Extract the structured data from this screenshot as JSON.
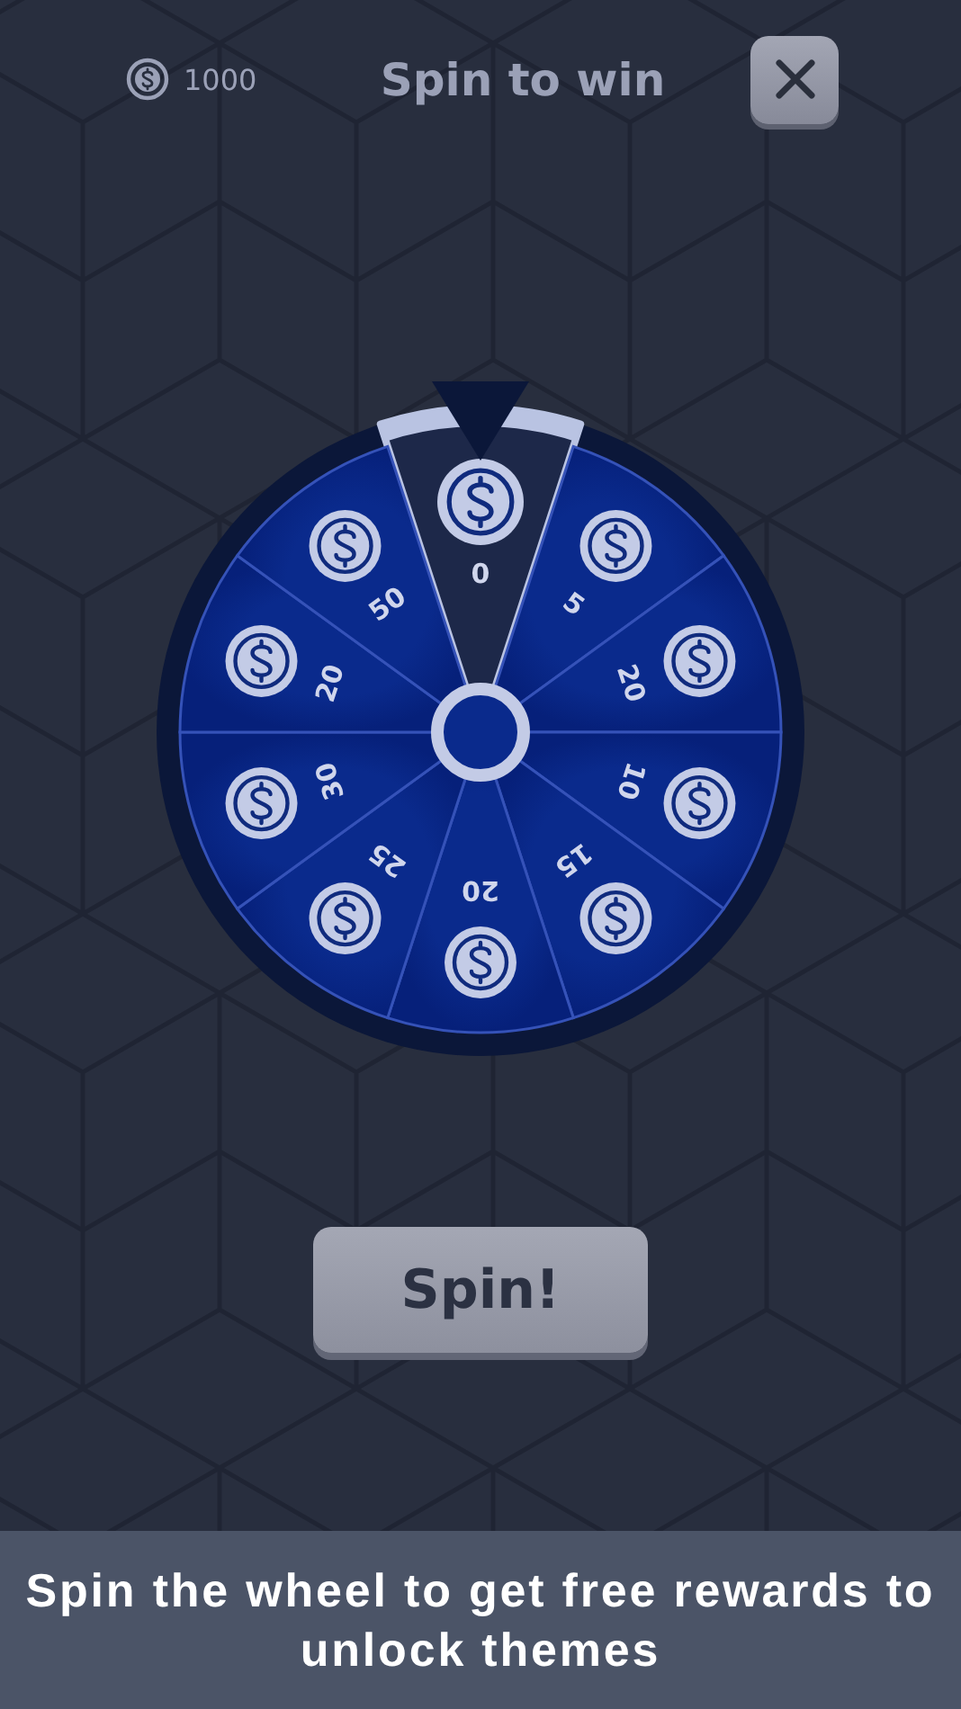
{
  "header": {
    "balance": "1000",
    "title": "Spin to win"
  },
  "wheel": {
    "segments": [
      {
        "value": "0",
        "selected": true
      },
      {
        "value": "5",
        "selected": false
      },
      {
        "value": "20",
        "selected": false
      },
      {
        "value": "10",
        "selected": false
      },
      {
        "value": "15",
        "selected": false
      },
      {
        "value": "20",
        "selected": false
      },
      {
        "value": "25",
        "selected": false
      },
      {
        "value": "30",
        "selected": false
      },
      {
        "value": "20",
        "selected": false
      },
      {
        "value": "50",
        "selected": false
      }
    ]
  },
  "spin_button": "Spin!",
  "caption": "Spin the wheel to get free rewards to unlock themes"
}
